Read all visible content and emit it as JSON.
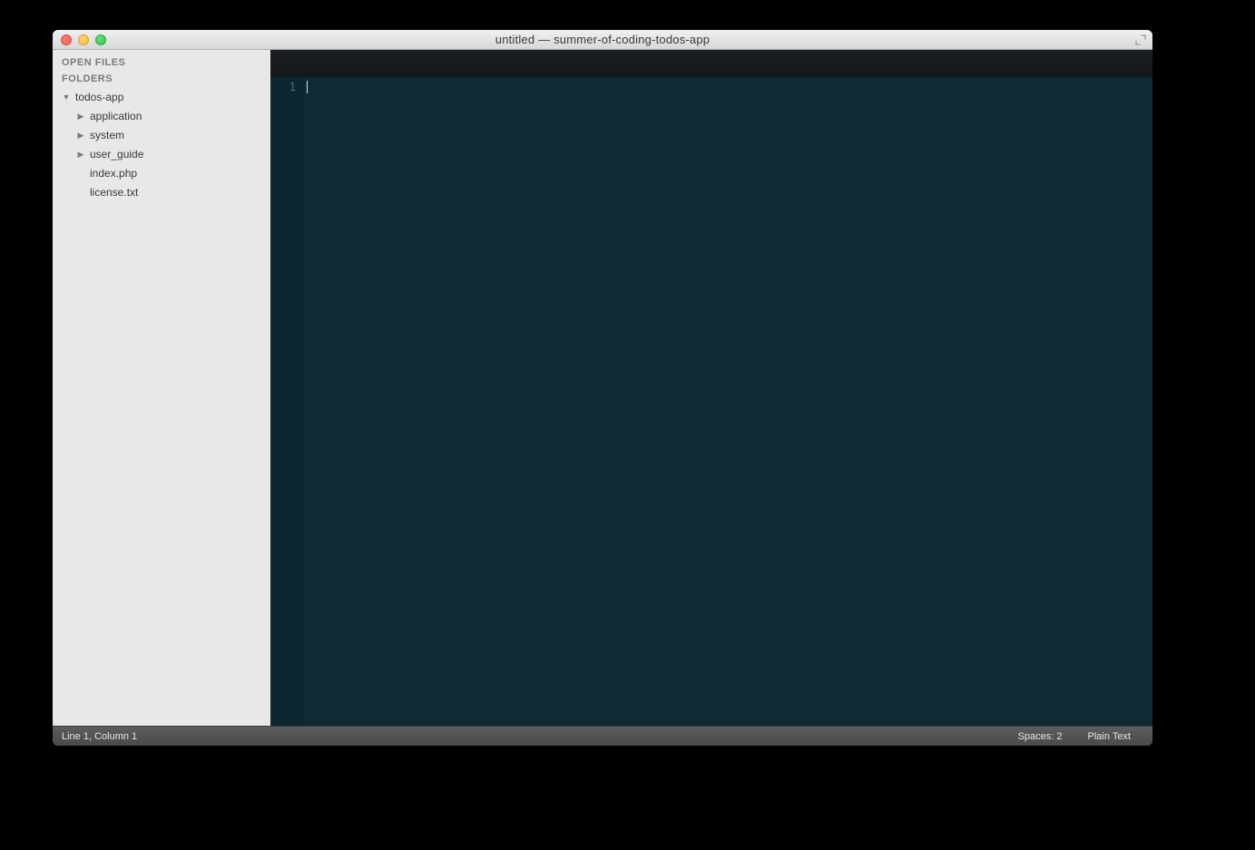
{
  "window": {
    "title": "untitled — summer-of-coding-todos-app"
  },
  "sidebar": {
    "open_files_label": "OPEN FILES",
    "folders_label": "FOLDERS",
    "root": {
      "name": "todos-app",
      "expanded": true,
      "children": [
        {
          "name": "application",
          "type": "folder"
        },
        {
          "name": "system",
          "type": "folder"
        },
        {
          "name": "user_guide",
          "type": "folder"
        },
        {
          "name": "index.php",
          "type": "file"
        },
        {
          "name": "license.txt",
          "type": "file"
        }
      ]
    }
  },
  "editor": {
    "gutter": {
      "line1": "1"
    }
  },
  "statusbar": {
    "position": "Line 1, Column 1",
    "indent": "Spaces: 2",
    "syntax": "Plain Text"
  }
}
